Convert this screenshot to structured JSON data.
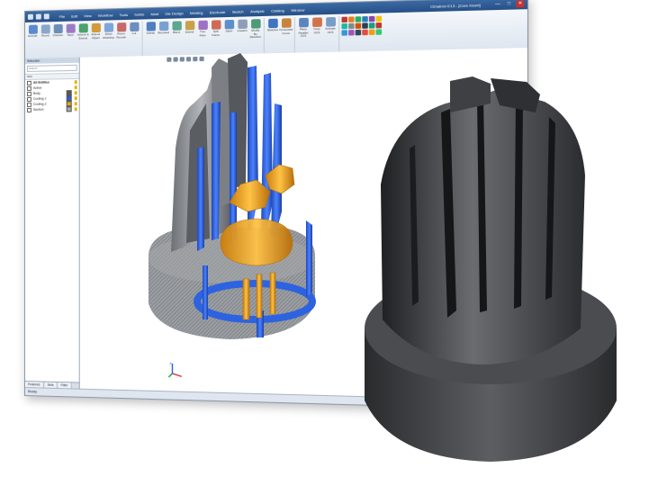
{
  "window": {
    "title": "Cimatron E13 - [Core Insert]",
    "menu": [
      "File",
      "Edit",
      "View",
      "Workflow",
      "Tools",
      "Solids",
      "Mold",
      "Die Design",
      "Molding",
      "Electrode",
      "Sketch",
      "Analysis",
      "Catalog",
      "Window"
    ],
    "controls": [
      "—",
      "□",
      "✕"
    ]
  },
  "ribbon": {
    "groups": [
      {
        "tools": [
          {
            "label": "Extrude",
            "color": "#5b8ad0"
          },
          {
            "label": "Round",
            "color": "#8aa7c9"
          },
          {
            "label": "Chamfer",
            "color": "#6d8fb7"
          },
          {
            "label": "Taper",
            "color": "#9d7bc4"
          },
          {
            "label": "Volume & Extend",
            "color": "#4aa36a"
          },
          {
            "label": "Extend Object",
            "color": "#d39a3a"
          },
          {
            "label": "Sheet Modeling",
            "color": "#7fa6d8"
          },
          {
            "label": "Recon Rounds",
            "color": "#c76a6a"
          },
          {
            "label": "Cut",
            "color": "#6b8fbf"
          }
        ]
      },
      {
        "tools": [
          {
            "label": "Sweep",
            "color": "#4f7fc2"
          },
          {
            "label": "Bounded",
            "color": "#7aa0d0"
          },
          {
            "label": "Blend",
            "color": "#5ea68c"
          },
          {
            "label": "Extend",
            "color": "#c9a247"
          },
          {
            "label": "Trim Face",
            "color": "#a071c2"
          },
          {
            "label": "Split Faces",
            "color": "#cf6b55"
          },
          {
            "label": "Stitch",
            "color": "#5d8fca"
          },
          {
            "label": "Unstitch",
            "color": "#8d9fb8"
          },
          {
            "label": "Modify By Direction",
            "color": "#4f9a78"
          }
        ]
      },
      {
        "tools": [
          {
            "label": "Sketcher",
            "color": "#3e74c0"
          },
          {
            "label": "Composite Curve",
            "color": "#c8843c"
          }
        ]
      },
      {
        "tools": [
          {
            "label": "Place Parallel UCS",
            "color": "#5c85be"
          },
          {
            "label": "Copy UCS",
            "color": "#d27248"
          },
          {
            "label": "Activate UCS",
            "color": "#7a9cc8"
          }
        ]
      }
    ],
    "mini_colors": [
      "#c0392b",
      "#e67e22",
      "#27ae60",
      "#2980b9",
      "#8e44ad",
      "#f1c40f",
      "#1abc9c",
      "#7f8c8d",
      "#d35400",
      "#2c3e50",
      "#16a085",
      "#c0392b",
      "#3498db",
      "#9b59b6",
      "#34495e",
      "#e74c3c",
      "#f39c12",
      "#2ecc71"
    ]
  },
  "panel": {
    "header": "Selection",
    "search_placeholder": "Search",
    "column_header": "Sets",
    "layers": [
      {
        "name": "All Entities",
        "color": "#ffffff",
        "bold": true
      },
      {
        "name": "Active",
        "color": "#ffffff"
      },
      {
        "name": "Body",
        "color": "#5a5a5a"
      },
      {
        "name": "Cooling 1",
        "color": "#2e5fd6"
      },
      {
        "name": "Cooling 2",
        "color": "#e3a21a"
      },
      {
        "name": "Section",
        "color": "#a8a8a8"
      }
    ],
    "tabs": [
      "Features",
      "Sets",
      "Filter"
    ]
  },
  "status": {
    "text": "Ready"
  },
  "colors": {
    "body_gray": "#8b8f94",
    "cooling_blue": "#2a5fd8",
    "cooling_orange": "#e3a21a",
    "printed_metal": "#3d3f42"
  },
  "icons": {
    "triad": "xyz-axis-triad-icon"
  }
}
